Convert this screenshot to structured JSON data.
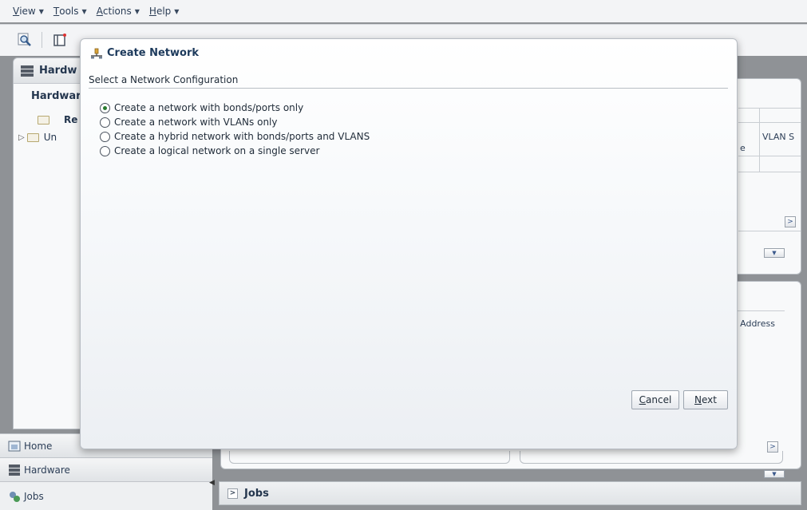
{
  "menubar": {
    "items": [
      {
        "label": "View",
        "mnemonic": "V",
        "rest": "iew"
      },
      {
        "label": "Tools",
        "mnemonic": "T",
        "rest": "ools"
      },
      {
        "label": "Actions",
        "mnemonic": "A",
        "rest": "ctions"
      },
      {
        "label": "Help",
        "mnemonic": "H",
        "rest": "elp"
      }
    ]
  },
  "toolbar": {
    "icons": [
      "search-icon",
      "new-window-icon"
    ]
  },
  "left_panel": {
    "header": "Hardw",
    "subheader": "Hardwar",
    "tree": [
      {
        "label": "Re"
      },
      {
        "label": "Un"
      }
    ]
  },
  "nav": {
    "home": "Home",
    "hardware": "Hardware",
    "jobs": "Jobs"
  },
  "jobs_bar": {
    "title": "Jobs"
  },
  "right_panel1": {
    "col_vlan": "VLAN S",
    "col_e": "e"
  },
  "right_panel2": {
    "col_ip": "P Address"
  },
  "dialog": {
    "title": "Create Network",
    "subtitle": "Select a Network Configuration",
    "options": [
      {
        "label": "Create a network with bonds/ports only",
        "selected": true
      },
      {
        "label": "Create a network with VLANs only",
        "selected": false
      },
      {
        "label": "Create a hybrid network with bonds/ports and VLANS",
        "selected": false
      },
      {
        "label": "Create a logical network on a single server",
        "selected": false
      }
    ],
    "cancel": {
      "mnemonic": "C",
      "rest": "ancel"
    },
    "next": {
      "mnemonic": "N",
      "rest": "ext"
    }
  },
  "colors": {
    "accent": "#1d3a5c",
    "radio_selected": "#287a2e"
  }
}
